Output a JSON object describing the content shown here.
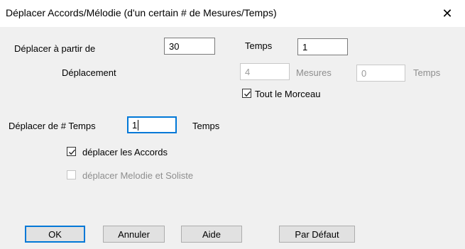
{
  "dialog": {
    "title": "Déplacer Accords/Mélodie (d'un certain # de Mesures/Temps)",
    "close_glyph": "✕"
  },
  "start": {
    "label": "Déplacer à partir de",
    "value": "30",
    "beat_label": "Temps",
    "beat_value": "1"
  },
  "displacement": {
    "label": "Déplacement",
    "measures_value": "4",
    "measures_label": "Mesures",
    "beats_value": "0",
    "beats_label": "Temps"
  },
  "whole_song": {
    "label": "Tout le Morceau",
    "checked": true
  },
  "shift": {
    "label": "Déplacer de # Temps",
    "value": "1",
    "unit_label": "Temps"
  },
  "options": {
    "chords": {
      "label": "déplacer les Accords",
      "checked": true
    },
    "melody": {
      "label": "déplacer Melodie et Soliste",
      "checked": false,
      "disabled": true
    }
  },
  "buttons": {
    "ok": "OK",
    "cancel": "Annuler",
    "help": "Aide",
    "default": "Par Défaut"
  },
  "colors": {
    "accent": "#0078d7",
    "window_bg": "#f0f0f0",
    "disabled_text": "#8e8e8e"
  }
}
